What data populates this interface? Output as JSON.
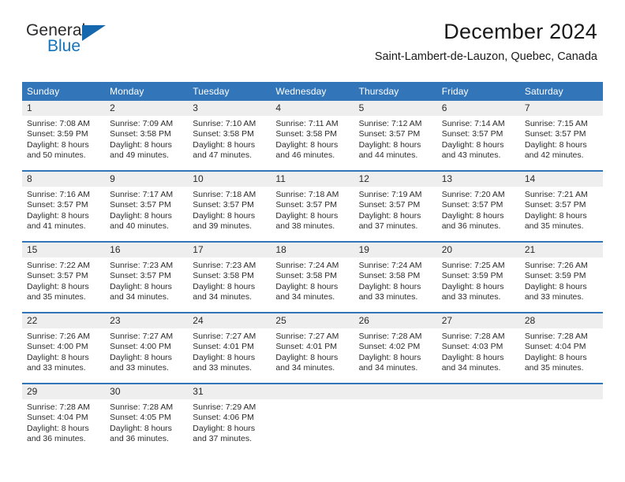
{
  "brand": {
    "word1": "General",
    "word2": "Blue",
    "accent_color": "#1567ae"
  },
  "header": {
    "title": "December 2024",
    "subtitle": "Saint-Lambert-de-Lauzon, Quebec, Canada"
  },
  "calendar": {
    "header_bg": "#3275b9",
    "daynum_bg": "#eeeeee",
    "weekdays": [
      "Sunday",
      "Monday",
      "Tuesday",
      "Wednesday",
      "Thursday",
      "Friday",
      "Saturday"
    ],
    "weeks": [
      [
        {
          "day": "1",
          "sunrise": "Sunrise: 7:08 AM",
          "sunset": "Sunset: 3:59 PM",
          "daylight1": "Daylight: 8 hours",
          "daylight2": "and 50 minutes."
        },
        {
          "day": "2",
          "sunrise": "Sunrise: 7:09 AM",
          "sunset": "Sunset: 3:58 PM",
          "daylight1": "Daylight: 8 hours",
          "daylight2": "and 49 minutes."
        },
        {
          "day": "3",
          "sunrise": "Sunrise: 7:10 AM",
          "sunset": "Sunset: 3:58 PM",
          "daylight1": "Daylight: 8 hours",
          "daylight2": "and 47 minutes."
        },
        {
          "day": "4",
          "sunrise": "Sunrise: 7:11 AM",
          "sunset": "Sunset: 3:58 PM",
          "daylight1": "Daylight: 8 hours",
          "daylight2": "and 46 minutes."
        },
        {
          "day": "5",
          "sunrise": "Sunrise: 7:12 AM",
          "sunset": "Sunset: 3:57 PM",
          "daylight1": "Daylight: 8 hours",
          "daylight2": "and 44 minutes."
        },
        {
          "day": "6",
          "sunrise": "Sunrise: 7:14 AM",
          "sunset": "Sunset: 3:57 PM",
          "daylight1": "Daylight: 8 hours",
          "daylight2": "and 43 minutes."
        },
        {
          "day": "7",
          "sunrise": "Sunrise: 7:15 AM",
          "sunset": "Sunset: 3:57 PM",
          "daylight1": "Daylight: 8 hours",
          "daylight2": "and 42 minutes."
        }
      ],
      [
        {
          "day": "8",
          "sunrise": "Sunrise: 7:16 AM",
          "sunset": "Sunset: 3:57 PM",
          "daylight1": "Daylight: 8 hours",
          "daylight2": "and 41 minutes."
        },
        {
          "day": "9",
          "sunrise": "Sunrise: 7:17 AM",
          "sunset": "Sunset: 3:57 PM",
          "daylight1": "Daylight: 8 hours",
          "daylight2": "and 40 minutes."
        },
        {
          "day": "10",
          "sunrise": "Sunrise: 7:18 AM",
          "sunset": "Sunset: 3:57 PM",
          "daylight1": "Daylight: 8 hours",
          "daylight2": "and 39 minutes."
        },
        {
          "day": "11",
          "sunrise": "Sunrise: 7:18 AM",
          "sunset": "Sunset: 3:57 PM",
          "daylight1": "Daylight: 8 hours",
          "daylight2": "and 38 minutes."
        },
        {
          "day": "12",
          "sunrise": "Sunrise: 7:19 AM",
          "sunset": "Sunset: 3:57 PM",
          "daylight1": "Daylight: 8 hours",
          "daylight2": "and 37 minutes."
        },
        {
          "day": "13",
          "sunrise": "Sunrise: 7:20 AM",
          "sunset": "Sunset: 3:57 PM",
          "daylight1": "Daylight: 8 hours",
          "daylight2": "and 36 minutes."
        },
        {
          "day": "14",
          "sunrise": "Sunrise: 7:21 AM",
          "sunset": "Sunset: 3:57 PM",
          "daylight1": "Daylight: 8 hours",
          "daylight2": "and 35 minutes."
        }
      ],
      [
        {
          "day": "15",
          "sunrise": "Sunrise: 7:22 AM",
          "sunset": "Sunset: 3:57 PM",
          "daylight1": "Daylight: 8 hours",
          "daylight2": "and 35 minutes."
        },
        {
          "day": "16",
          "sunrise": "Sunrise: 7:23 AM",
          "sunset": "Sunset: 3:57 PM",
          "daylight1": "Daylight: 8 hours",
          "daylight2": "and 34 minutes."
        },
        {
          "day": "17",
          "sunrise": "Sunrise: 7:23 AM",
          "sunset": "Sunset: 3:58 PM",
          "daylight1": "Daylight: 8 hours",
          "daylight2": "and 34 minutes."
        },
        {
          "day": "18",
          "sunrise": "Sunrise: 7:24 AM",
          "sunset": "Sunset: 3:58 PM",
          "daylight1": "Daylight: 8 hours",
          "daylight2": "and 34 minutes."
        },
        {
          "day": "19",
          "sunrise": "Sunrise: 7:24 AM",
          "sunset": "Sunset: 3:58 PM",
          "daylight1": "Daylight: 8 hours",
          "daylight2": "and 33 minutes."
        },
        {
          "day": "20",
          "sunrise": "Sunrise: 7:25 AM",
          "sunset": "Sunset: 3:59 PM",
          "daylight1": "Daylight: 8 hours",
          "daylight2": "and 33 minutes."
        },
        {
          "day": "21",
          "sunrise": "Sunrise: 7:26 AM",
          "sunset": "Sunset: 3:59 PM",
          "daylight1": "Daylight: 8 hours",
          "daylight2": "and 33 minutes."
        }
      ],
      [
        {
          "day": "22",
          "sunrise": "Sunrise: 7:26 AM",
          "sunset": "Sunset: 4:00 PM",
          "daylight1": "Daylight: 8 hours",
          "daylight2": "and 33 minutes."
        },
        {
          "day": "23",
          "sunrise": "Sunrise: 7:27 AM",
          "sunset": "Sunset: 4:00 PM",
          "daylight1": "Daylight: 8 hours",
          "daylight2": "and 33 minutes."
        },
        {
          "day": "24",
          "sunrise": "Sunrise: 7:27 AM",
          "sunset": "Sunset: 4:01 PM",
          "daylight1": "Daylight: 8 hours",
          "daylight2": "and 33 minutes."
        },
        {
          "day": "25",
          "sunrise": "Sunrise: 7:27 AM",
          "sunset": "Sunset: 4:01 PM",
          "daylight1": "Daylight: 8 hours",
          "daylight2": "and 34 minutes."
        },
        {
          "day": "26",
          "sunrise": "Sunrise: 7:28 AM",
          "sunset": "Sunset: 4:02 PM",
          "daylight1": "Daylight: 8 hours",
          "daylight2": "and 34 minutes."
        },
        {
          "day": "27",
          "sunrise": "Sunrise: 7:28 AM",
          "sunset": "Sunset: 4:03 PM",
          "daylight1": "Daylight: 8 hours",
          "daylight2": "and 34 minutes."
        },
        {
          "day": "28",
          "sunrise": "Sunrise: 7:28 AM",
          "sunset": "Sunset: 4:04 PM",
          "daylight1": "Daylight: 8 hours",
          "daylight2": "and 35 minutes."
        }
      ],
      [
        {
          "day": "29",
          "sunrise": "Sunrise: 7:28 AM",
          "sunset": "Sunset: 4:04 PM",
          "daylight1": "Daylight: 8 hours",
          "daylight2": "and 36 minutes."
        },
        {
          "day": "30",
          "sunrise": "Sunrise: 7:28 AM",
          "sunset": "Sunset: 4:05 PM",
          "daylight1": "Daylight: 8 hours",
          "daylight2": "and 36 minutes."
        },
        {
          "day": "31",
          "sunrise": "Sunrise: 7:29 AM",
          "sunset": "Sunset: 4:06 PM",
          "daylight1": "Daylight: 8 hours",
          "daylight2": "and 37 minutes."
        },
        {
          "day": "",
          "sunrise": "",
          "sunset": "",
          "daylight1": "",
          "daylight2": ""
        },
        {
          "day": "",
          "sunrise": "",
          "sunset": "",
          "daylight1": "",
          "daylight2": ""
        },
        {
          "day": "",
          "sunrise": "",
          "sunset": "",
          "daylight1": "",
          "daylight2": ""
        },
        {
          "day": "",
          "sunrise": "",
          "sunset": "",
          "daylight1": "",
          "daylight2": ""
        }
      ]
    ]
  }
}
